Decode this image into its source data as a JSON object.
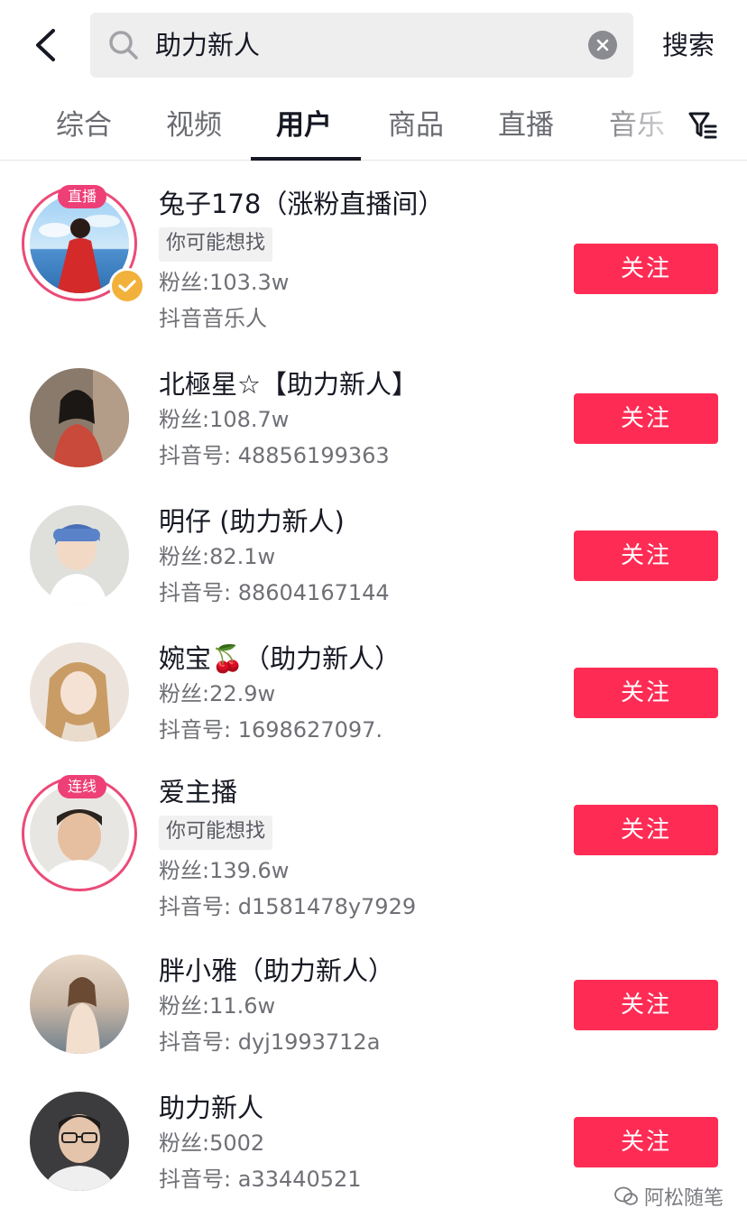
{
  "search": {
    "query": "助力新人",
    "submit_label": "搜索"
  },
  "tabs": [
    {
      "label": "综合"
    },
    {
      "label": "视频"
    },
    {
      "label": "用户",
      "active": true
    },
    {
      "label": "商品"
    },
    {
      "label": "直播"
    },
    {
      "label": "音乐"
    }
  ],
  "users": [
    {
      "name": "兔子178（涨粉直播间）",
      "badge": "直播",
      "verified": true,
      "tag": "你可能想找",
      "fans": "粉丝:103.3w",
      "extra": "抖音音乐人",
      "follow_label": "关注"
    },
    {
      "name": "北極星☆【助力新人】",
      "fans": "粉丝:108.7w",
      "extra": "抖音号: 48856199363",
      "follow_label": "关注"
    },
    {
      "name": "明仔 (助力新人)",
      "fans": "粉丝:82.1w",
      "extra": "抖音号: 88604167144",
      "follow_label": "关注"
    },
    {
      "name": "婉宝🍒（助力新人）",
      "fans": "粉丝:22.9w",
      "extra": "抖音号: 1698627097.",
      "follow_label": "关注"
    },
    {
      "name": "爱主播",
      "badge": "连线",
      "tag": "你可能想找",
      "fans": "粉丝:139.6w",
      "extra": "抖音号: d1581478y7929",
      "follow_label": "关注"
    },
    {
      "name": "胖小雅（助力新人）",
      "fans": "粉丝:11.6w",
      "extra": "抖音号: dyj1993712a",
      "follow_label": "关注"
    },
    {
      "name": "助力新人",
      "fans": "粉丝:5002",
      "extra": "抖音号: a33440521",
      "follow_label": "关注"
    }
  ],
  "watermark": {
    "text": "阿松随笔"
  },
  "colors": {
    "accent": "#fe2c55",
    "live_ring": "#ea4b78",
    "verified": "#f2b13a"
  }
}
